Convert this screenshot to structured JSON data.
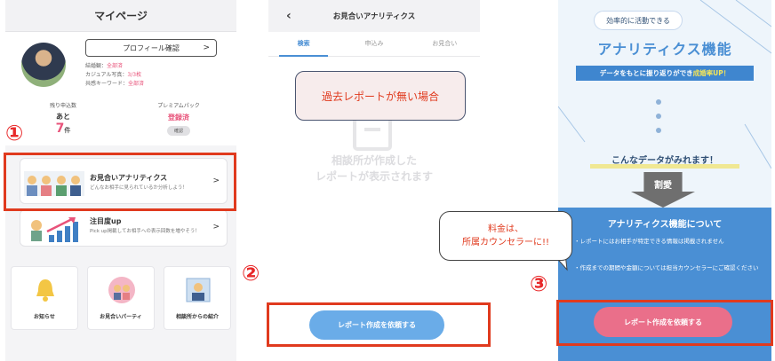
{
  "panel1": {
    "title": "マイページ",
    "profile_button": "プロフィール確認",
    "info": [
      {
        "label": "結婚観：",
        "value": "全部済"
      },
      {
        "label": "カジュアル写真：",
        "value": "3/3枚"
      },
      {
        "label": "共感キーワード：",
        "value": "全部済"
      }
    ],
    "stat_left": {
      "label": "残り申込数",
      "prefix": "あと",
      "count": "7",
      "unit": "件"
    },
    "stat_right": {
      "label": "プレミアムパック",
      "value": "登録済",
      "chip": "確認"
    },
    "marker": "①",
    "analytics": {
      "title": "お見合いアナリティクス",
      "sub": "どんなお相手に見られているか分析しよう！"
    },
    "attention": {
      "title": "注目度up",
      "sub": "Pick up掲載してお相手への表示回数を増やそう！"
    },
    "tiles": [
      "お知らせ",
      "お見合いパーティ",
      "相談所からの紹介"
    ]
  },
  "panel2": {
    "title": "お見合いアナリティクス",
    "tabs": [
      "検索",
      "申込み",
      "お見合い"
    ],
    "callout": "過去レポートが無い場合",
    "empty_line1": "相談所が作成した",
    "empty_line2": "レポートが表示されます",
    "marker": "②",
    "button": "レポート作成を依頼する"
  },
  "panel3": {
    "badge": "効率的に活動できる",
    "hero_title": "アナリティクス機能",
    "strip_text": "データをもとに振り返りができ",
    "strip_highlight": "成婚率UP！",
    "sub_hero": "こんなデータがみれます！",
    "arrow_label": "割愛",
    "box_title": "アナリティクス機能について",
    "box_item1": "・レポートにはお相手が特定できる情報は掲載されません",
    "box_item2": "・作成までの期間や金額については担当カウンセラーにご確認ください",
    "marker": "③",
    "button": "レポート作成を依頼する"
  },
  "speech": {
    "line1": "料金は、",
    "line2": "所属カウンセラーに!!"
  },
  "colors": {
    "accent_red": "#e03a1e",
    "pink": "#e8537a",
    "blue": "#4a8fd4"
  }
}
